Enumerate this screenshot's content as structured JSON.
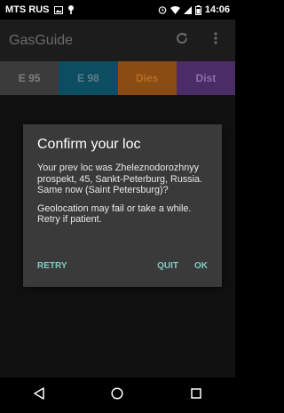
{
  "status_bar": {
    "carrier": "MTS RUS",
    "time": "14:06",
    "icons": [
      "image-icon",
      "pin-icon",
      "alarm-icon",
      "wifi-icon",
      "signal-icon",
      "battery-icon"
    ]
  },
  "app_bar": {
    "title": "GasGuide",
    "actions": [
      "refresh-icon",
      "overflow-menu-icon"
    ]
  },
  "tabs": [
    {
      "label": "E 95",
      "color": "#3b3b3b"
    },
    {
      "label": "E 98",
      "color": "#0d4d61"
    },
    {
      "label": "Dies",
      "color": "#8a4c12"
    },
    {
      "label": "Dist",
      "color": "#4b2c67"
    }
  ],
  "dialog": {
    "title": "Confirm your loc",
    "message_1": "Your prev loc was Zheleznodorozhnyy prospekt, 45, Sankt-Peterburg, Russia. Same now (Saint Petersburg)?",
    "message_2": "Geolocation may fail or take a while. Retry if patient.",
    "buttons": {
      "retry": "RETRY",
      "quit": "QUIT",
      "ok": "OK"
    },
    "accent_color": "#80cbc4"
  },
  "nav_bar": {
    "buttons": [
      "back-icon",
      "home-icon",
      "recents-icon"
    ]
  }
}
